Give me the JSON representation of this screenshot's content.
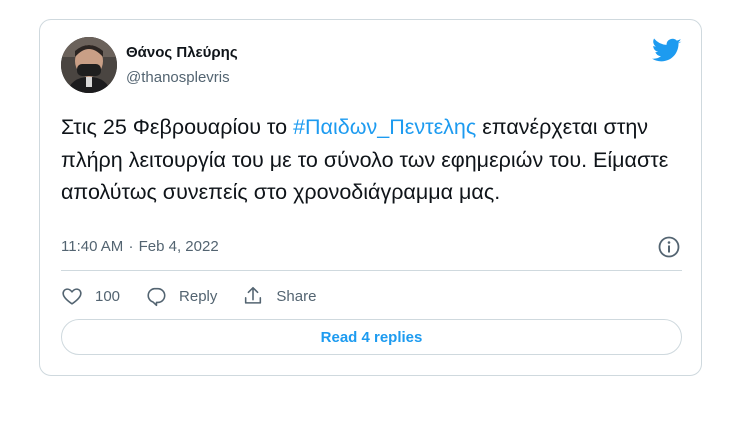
{
  "tweet": {
    "author_name": "Θάνος Πλεύρης",
    "author_handle": "@thanosplevris",
    "text_before": "Στις 25 Φεβρουαρίου το ",
    "hashtag": "#Παιδων_Πεντελης",
    "text_after": " επανέρχεται στην πλήρη λειτουργία του με το σύνολο των εφημεριών του. Είμαστε απολύτως συνεπείς στο χρονοδιάγραμμα μας.",
    "time": "11:40 AM",
    "separator": "·",
    "date": "Feb 4, 2022"
  },
  "actions": {
    "like_count": "100",
    "reply_label": "Reply",
    "share_label": "Share"
  },
  "read_replies_label": "Read 4 replies",
  "icons": {
    "brand": "twitter-bird-icon",
    "info": "info-icon",
    "like": "heart-icon",
    "reply": "speech-bubble-icon",
    "share": "share-icon"
  },
  "colors": {
    "accent": "#1d9bf0",
    "text": "#0f1419",
    "muted": "#536471",
    "border": "#cfd9de"
  }
}
